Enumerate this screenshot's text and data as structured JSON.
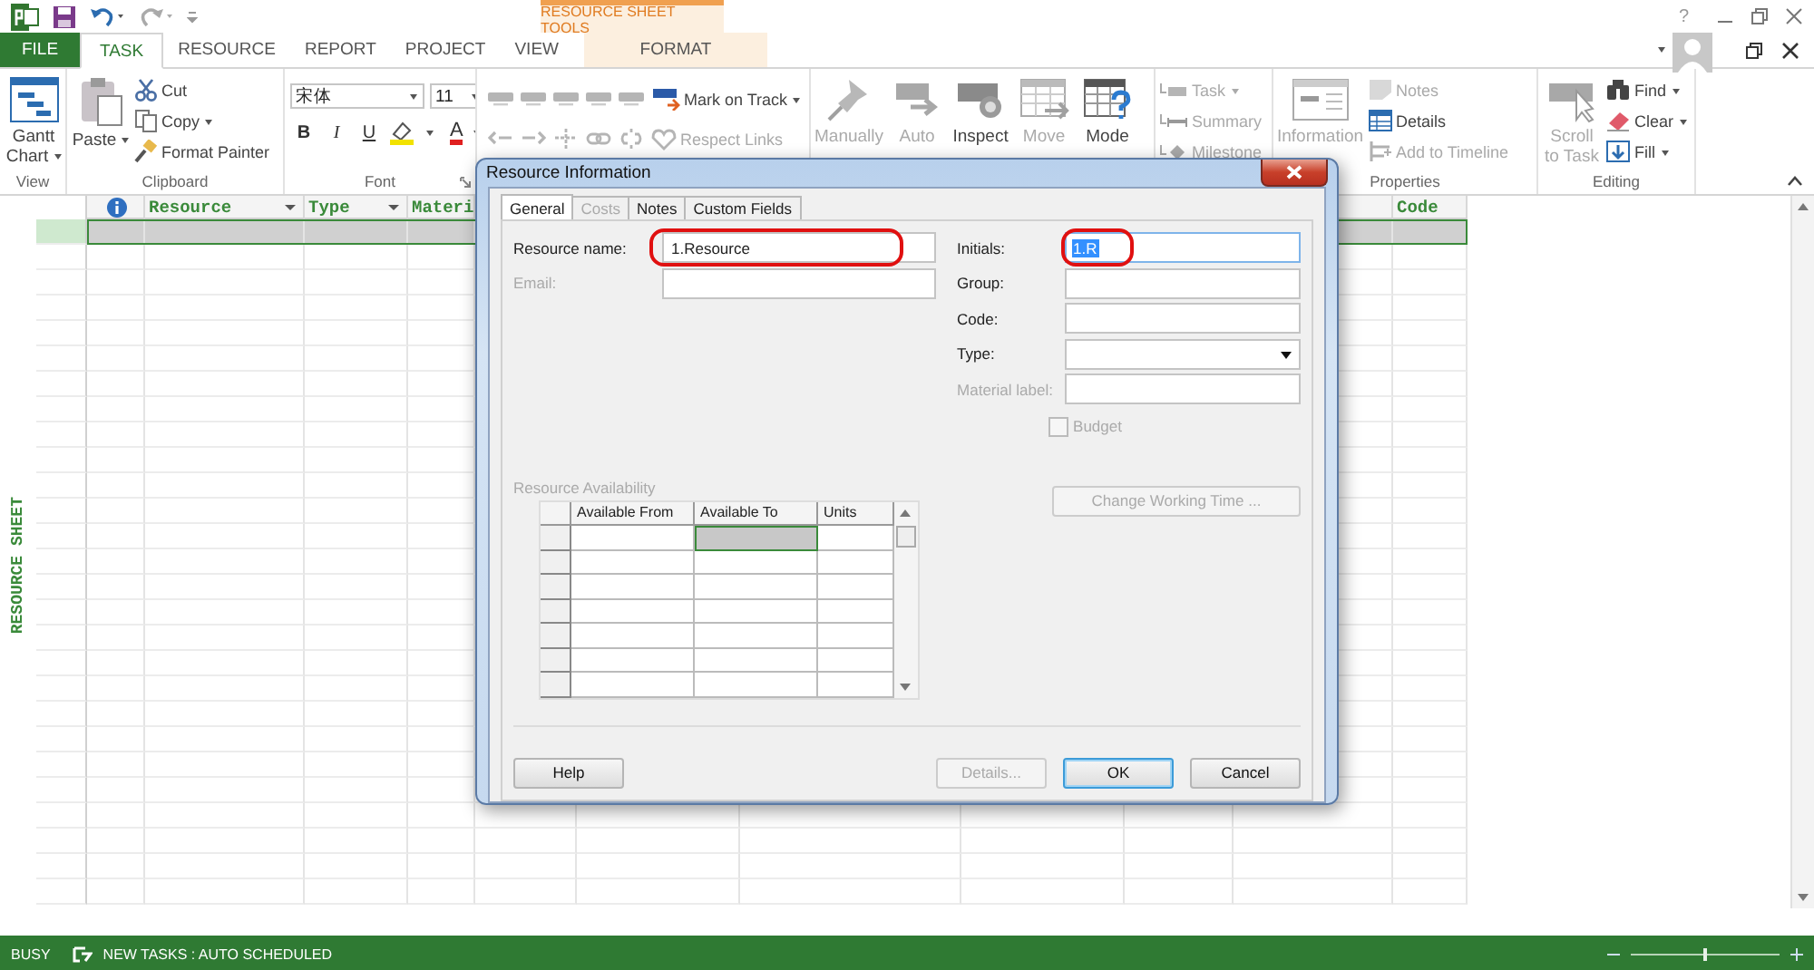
{
  "app": {
    "contextual_title": "RESOURCE SHEET TOOLS",
    "help": "?"
  },
  "tabs": [
    {
      "label": "FILE",
      "kind": "file",
      "selected": false
    },
    {
      "label": "TASK",
      "kind": "tab",
      "selected": true
    },
    {
      "label": "RESOURCE",
      "kind": "tab",
      "selected": false
    },
    {
      "label": "REPORT",
      "kind": "tab",
      "selected": false
    },
    {
      "label": "PROJECT",
      "kind": "tab",
      "selected": false
    },
    {
      "label": "VIEW",
      "kind": "tab",
      "selected": false
    },
    {
      "label": "FORMAT",
      "kind": "contextual",
      "selected": false
    }
  ],
  "ribbon": [
    {
      "kind": "buttons",
      "label": "View",
      "items": [
        {
          "kind": "large",
          "label": "Gantt Chart",
          "dropdown": true,
          "disabled": false
        }
      ]
    },
    {
      "kind": "buttons",
      "label": "Clipboard",
      "items": [
        {
          "kind": "large",
          "label": "Paste",
          "dropdown": true,
          "disabled": false
        },
        {
          "kind": "small",
          "label": "Cut",
          "dropdown": false,
          "disabled": false
        },
        {
          "kind": "small",
          "label": "Copy",
          "dropdown": true,
          "disabled": false
        },
        {
          "kind": "small",
          "label": "Format Painter",
          "dropdown": false,
          "disabled": false
        }
      ]
    },
    {
      "kind": "font",
      "label": "Font",
      "font_name": "宋体",
      "font_size": "11",
      "styles": [
        "B",
        "I",
        "U"
      ],
      "font_color": "A"
    },
    {
      "kind": "schedule",
      "items": [
        {
          "kind": "small",
          "label": "Mark on Track",
          "dropdown": true,
          "disabled": false
        },
        {
          "kind": "small",
          "label": "Respect Links",
          "dropdown": false,
          "disabled": true
        }
      ]
    },
    {
      "kind": "buttons",
      "items": [
        {
          "kind": "large",
          "label": "Manually",
          "dropdown": false,
          "disabled": true
        },
        {
          "kind": "large",
          "label": "Auto",
          "dropdown": false,
          "disabled": true
        },
        {
          "kind": "large",
          "label": "Inspect",
          "dropdown": false,
          "disabled": false
        },
        {
          "kind": "large",
          "label": "Move",
          "dropdown": false,
          "disabled": true
        },
        {
          "kind": "large",
          "label": "Mode",
          "dropdown": false,
          "disabled": false
        }
      ]
    },
    {
      "kind": "buttons",
      "items": [
        {
          "kind": "small",
          "label": "Task",
          "dropdown": true,
          "disabled": true
        },
        {
          "kind": "small",
          "label": "Summary",
          "dropdown": false,
          "disabled": true
        },
        {
          "kind": "small",
          "label": "Milestone",
          "dropdown": false,
          "disabled": true
        }
      ]
    },
    {
      "kind": "buttons",
      "label": "Properties",
      "items": [
        {
          "kind": "large",
          "label": "Information",
          "dropdown": false,
          "disabled": true
        },
        {
          "kind": "small",
          "label": "Notes",
          "dropdown": false,
          "disabled": true
        },
        {
          "kind": "small",
          "label": "Details",
          "dropdown": false,
          "disabled": false
        },
        {
          "kind": "small",
          "label": "Add to Timeline",
          "dropdown": false,
          "disabled": true
        }
      ]
    },
    {
      "kind": "buttons",
      "label": "Editing",
      "items": [
        {
          "kind": "large",
          "label": "Scroll to Task",
          "dropdown": false,
          "disabled": true
        },
        {
          "kind": "small",
          "label": "Find",
          "dropdown": true,
          "disabled": false
        },
        {
          "kind": "small",
          "label": "Clear",
          "dropdown": true,
          "disabled": false
        },
        {
          "kind": "small",
          "label": "Fill",
          "dropdown": true,
          "disabled": false
        }
      ]
    }
  ],
  "sheet": {
    "side_label": "RESOURCE SHEET",
    "columns": [
      {
        "kind": "indicator"
      },
      {
        "kind": "field",
        "label": "Resource",
        "filter": true
      },
      {
        "kind": "field",
        "label": "Type",
        "filter": true
      },
      {
        "kind": "field",
        "label": "Materi",
        "filter": false
      },
      {
        "kind": "field",
        "label": "Code",
        "filter": false
      }
    ],
    "rows": [
      {
        "selected": true
      },
      {
        "selected": false
      },
      {
        "selected": false
      },
      {
        "selected": false
      },
      {
        "selected": false
      },
      {
        "selected": false
      },
      {
        "selected": false
      },
      {
        "selected": false
      },
      {
        "selected": false
      },
      {
        "selected": false
      },
      {
        "selected": false
      },
      {
        "selected": false
      },
      {
        "selected": false
      },
      {
        "selected": false
      },
      {
        "selected": false
      },
      {
        "selected": false
      },
      {
        "selected": false
      },
      {
        "selected": false
      },
      {
        "selected": false
      },
      {
        "selected": false
      },
      {
        "selected": false
      },
      {
        "selected": false
      },
      {
        "selected": false
      },
      {
        "selected": false
      },
      {
        "selected": false
      },
      {
        "selected": false
      },
      {
        "selected": false
      }
    ]
  },
  "dialog": {
    "title": "Resource Information",
    "tabs": [
      {
        "label": "General",
        "selected": true,
        "disabled": false
      },
      {
        "label": "Costs",
        "selected": false,
        "disabled": true
      },
      {
        "label": "Notes",
        "selected": false,
        "disabled": false
      },
      {
        "label": "Custom Fields",
        "selected": false,
        "disabled": false
      }
    ],
    "left_fields": [
      {
        "label": "Resource name:",
        "value": "1.Resource",
        "kind": "text",
        "disabled": false,
        "circled": true,
        "value_selected": false
      },
      {
        "label": "Email:",
        "kind": "text",
        "disabled": true,
        "circled": false,
        "value_selected": false
      }
    ],
    "right_fields": [
      {
        "label": "Initials:",
        "value": "1.R",
        "kind": "text",
        "disabled": false,
        "circled": true,
        "value_selected": true
      },
      {
        "label": "Group:",
        "kind": "text",
        "disabled": false,
        "circled": false,
        "value_selected": false
      },
      {
        "label": "Code:",
        "kind": "text",
        "disabled": false,
        "circled": false,
        "value_selected": false
      },
      {
        "label": "Type:",
        "kind": "select",
        "disabled": false,
        "circled": false,
        "value_selected": false
      },
      {
        "label": "Material label:",
        "kind": "text",
        "disabled": true,
        "circled": false,
        "value_selected": false
      }
    ],
    "budget": {
      "label": "Budget",
      "checked": false,
      "disabled": true
    },
    "availability": {
      "label": "Resource Availability",
      "disabled": true,
      "columns": [
        "Available From",
        "Available To",
        "Units"
      ],
      "rows": [
        {
          "cells": [
            {
              "selected": false
            },
            {
              "selected": true
            },
            {
              "selected": false
            }
          ]
        },
        {
          "cells": [
            {
              "selected": false
            },
            {
              "selected": false
            },
            {
              "selected": false
            }
          ]
        },
        {
          "cells": [
            {
              "selected": false
            },
            {
              "selected": false
            },
            {
              "selected": false
            }
          ]
        },
        {
          "cells": [
            {
              "selected": false
            },
            {
              "selected": false
            },
            {
              "selected": false
            }
          ]
        },
        {
          "cells": [
            {
              "selected": false
            },
            {
              "selected": false
            },
            {
              "selected": false
            }
          ]
        },
        {
          "cells": [
            {
              "selected": false
            },
            {
              "selected": false
            },
            {
              "selected": false
            }
          ]
        },
        {
          "cells": [
            {
              "selected": false
            },
            {
              "selected": false
            },
            {
              "selected": false
            }
          ]
        }
      ]
    },
    "change_working_time": {
      "label": "Change Working Time ...",
      "disabled": true
    },
    "buttons": [
      {
        "label": "Help",
        "kind": "left",
        "disabled": false
      },
      {
        "label": "Details...",
        "kind": "normal",
        "disabled": true
      },
      {
        "label": "OK",
        "kind": "default",
        "disabled": false
      },
      {
        "label": "Cancel",
        "kind": "normal",
        "disabled": false
      }
    ]
  },
  "status_bar": {
    "status": "BUSY",
    "mode": "NEW TASKS : AUTO SCHEDULED",
    "zoom": {
      "level": 0.5
    }
  }
}
